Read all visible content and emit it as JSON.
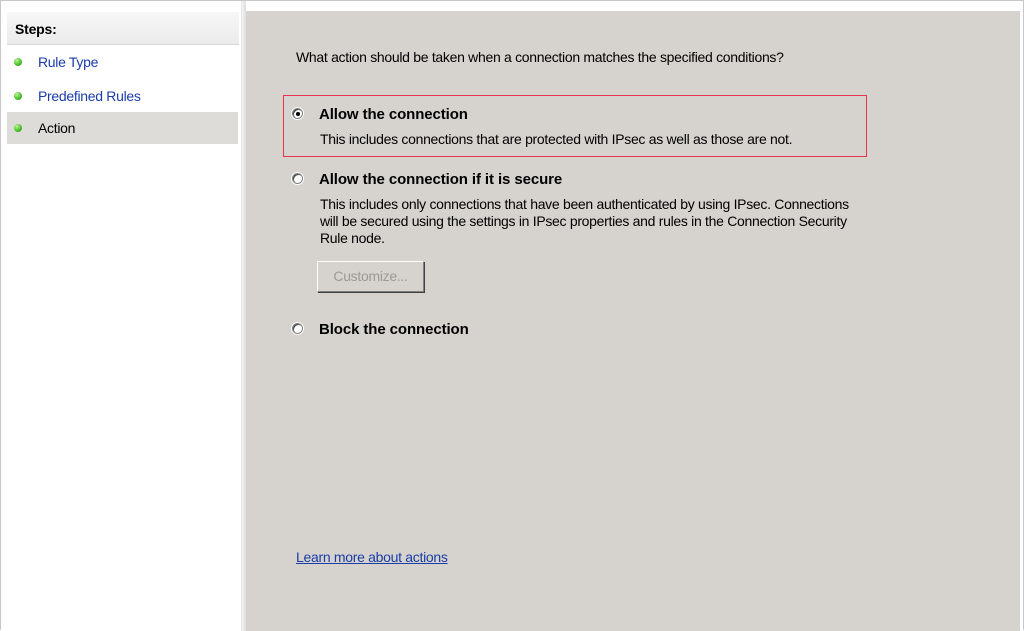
{
  "steps_panel": {
    "title": "Steps:",
    "items": [
      {
        "label": "Rule Type",
        "status": "completed"
      },
      {
        "label": "Predefined Rules",
        "status": "completed"
      },
      {
        "label": "Action",
        "status": "current"
      }
    ]
  },
  "content": {
    "question": "What action should be taken when a connection matches the specified conditions?",
    "options": [
      {
        "label": "Allow the connection",
        "description": "This includes connections that are protected with IPsec as well as those are not.",
        "checked": true,
        "highlighted": true
      },
      {
        "label": "Allow the connection if it is secure",
        "description_lines": [
          "This includes only connections that have been authenticated by using IPsec.  Connections",
          "will be secured using the settings in IPsec properties and rules in the Connection Security",
          "Rule node."
        ],
        "checked": false,
        "button": {
          "label": "Customize...",
          "enabled": false
        }
      },
      {
        "label": "Block the connection",
        "checked": false
      }
    ],
    "learn_more_link": "Learn more about actions"
  },
  "colors": {
    "content_background": "#d6d3ce",
    "link": "#1a3da8",
    "highlight_border": "#e8334f",
    "step_dot": "#4cc22c",
    "current_step_background": "#dedcd8"
  }
}
